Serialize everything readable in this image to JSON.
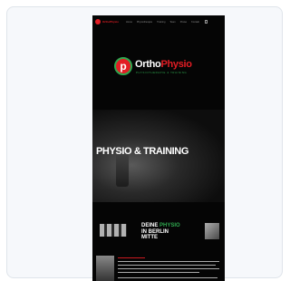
{
  "nav": {
    "logo_text": "OrthoPhysio",
    "items": [
      "Home",
      "Physiotherapie",
      "Training",
      "Team",
      "Preise",
      "Kontakt"
    ]
  },
  "logo": {
    "mark": "p",
    "word1": "Ortho",
    "word2": "Physio",
    "tagline": "PHYSIOTHERAPIE & TRAINING"
  },
  "hero": {
    "title": "PHYSIO & TRAINING"
  },
  "intro": {
    "line1_a": "DEINE ",
    "line1_b": "PHYSIO",
    "line2": "IN BERLIN",
    "line3": "MITTE"
  },
  "colors": {
    "brand_red": "#e21d24",
    "brand_green": "#2fa84f",
    "background": "#050505"
  }
}
